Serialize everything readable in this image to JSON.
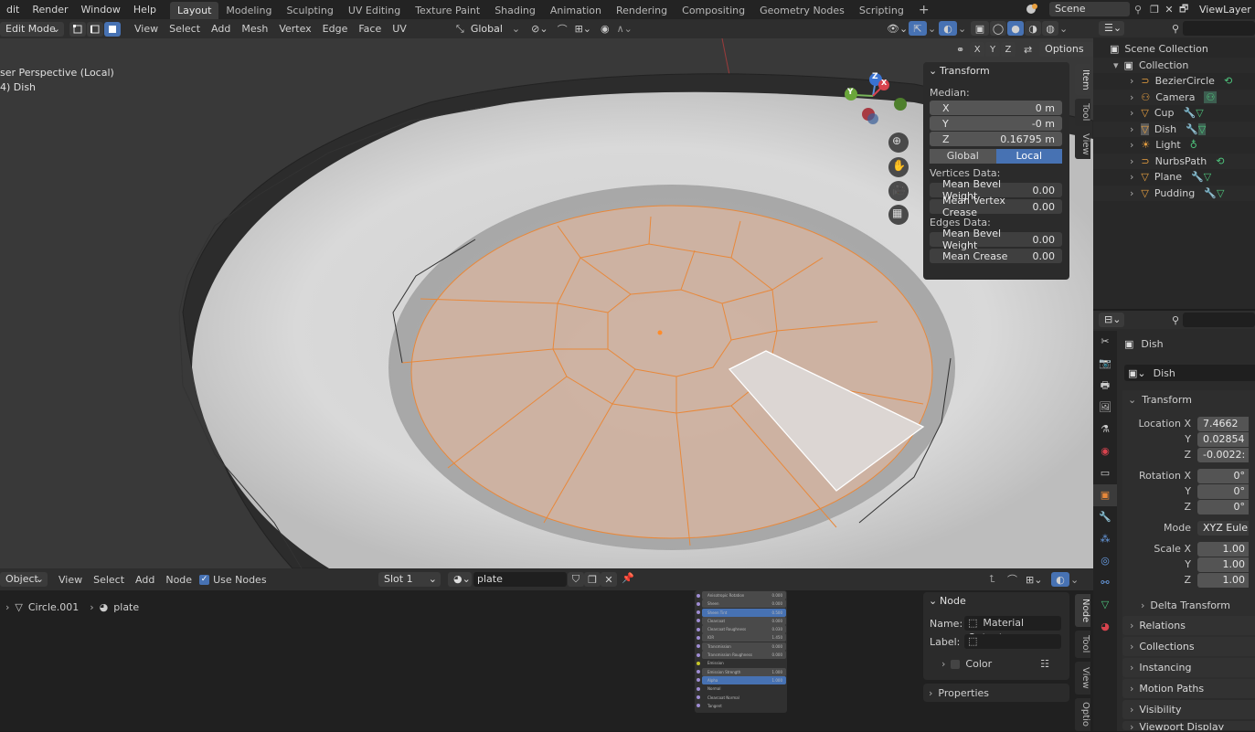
{
  "topbar": {
    "menus": [
      "dit",
      "Render",
      "Window",
      "Help"
    ],
    "workspace_tabs": [
      "Layout",
      "Modeling",
      "Sculpting",
      "UV Editing",
      "Texture Paint",
      "Shading",
      "Animation",
      "Rendering",
      "Compositing",
      "Geometry Nodes",
      "Scripting"
    ],
    "active_tab": "Layout",
    "add_tab": "+",
    "scene": "Scene",
    "view_layer": "ViewLayer"
  },
  "viewport_header": {
    "mode": "Edit Mode",
    "menus": [
      "View",
      "Select",
      "Add",
      "Mesh",
      "Vertex",
      "Edge",
      "Face",
      "UV"
    ],
    "orientation": "Global",
    "options_label": "Options",
    "axes": [
      "X",
      "Y",
      "Z"
    ]
  },
  "viewport": {
    "perspective_label": "ser Perspective (Local)",
    "object_label": "4) Dish",
    "gizmo_axes": [
      "Y",
      "Z",
      "X"
    ]
  },
  "npanel": {
    "title": "Transform",
    "median_label": "Median:",
    "x_label": "X",
    "x_value": "0 m",
    "y_label": "Y",
    "y_value": "-0 m",
    "z_label": "Z",
    "z_value": "0.16795 m",
    "global_label": "Global",
    "local_label": "Local",
    "vertices_data_label": "Vertices Data:",
    "mean_bevel_weight_label": "Mean Bevel Weight",
    "mean_bevel_weight_value": "0.00",
    "mean_vertex_crease_label": "Mean Vertex Crease",
    "mean_vertex_crease_value": "0.00",
    "edges_data_label": "Edges Data:",
    "edge_bevel_weight_label": "Mean Bevel Weight",
    "edge_bevel_weight_value": "0.00",
    "mean_crease_label": "Mean Crease",
    "mean_crease_value": "0.00",
    "side_tabs": [
      "Item",
      "Tool",
      "View"
    ]
  },
  "outliner": {
    "scene_collection": "Scene Collection",
    "collection": "Collection",
    "items": [
      {
        "name": "BezierCircle",
        "color": "#e8a040"
      },
      {
        "name": "Camera",
        "color": "#e8a040"
      },
      {
        "name": "Cup",
        "color": "#e8a040"
      },
      {
        "name": "Dish",
        "color": "#e8a040"
      },
      {
        "name": "Light",
        "color": "#e8a040"
      },
      {
        "name": "NurbsPath",
        "color": "#e8a040"
      },
      {
        "name": "Plane",
        "color": "#e8a040"
      },
      {
        "name": "Pudding",
        "color": "#e8a040"
      }
    ]
  },
  "properties": {
    "object_name": "Dish",
    "data_name": "Dish",
    "transform_label": "Transform",
    "location_x_label": "Location X",
    "location_x": "7.4662",
    "location_y_label": "Y",
    "location_y": "0.02854",
    "location_z_label": "Z",
    "location_z": "-0.0022:",
    "rotation_x_label": "Rotation X",
    "rotation_x": "0°",
    "rotation_y_label": "Y",
    "rotation_y": "0°",
    "rotation_z_label": "Z",
    "rotation_z": "0°",
    "mode_label": "Mode",
    "mode_value": "XYZ Euler",
    "scale_x_label": "Scale X",
    "scale_x": "1.00",
    "scale_y_label": "Y",
    "scale_y": "1.00",
    "scale_z_label": "Z",
    "scale_z": "1.00",
    "delta_transform": "Delta Transform",
    "sections": [
      "Relations",
      "Collections",
      "Instancing",
      "Motion Paths",
      "Visibility",
      "Viewport Display"
    ]
  },
  "node_editor": {
    "editor_type": "Object",
    "menus": [
      "View",
      "Select",
      "Add",
      "Node"
    ],
    "use_nodes_label": "Use Nodes",
    "slot": "Slot 1",
    "material": "plate",
    "breadcrumb_object": "Circle.001",
    "breadcrumb_material": "plate",
    "node_panel_title": "Node",
    "name_label": "Name:",
    "name_value": "Material Output",
    "label_label": "Label:",
    "label_value": "",
    "color_label": "Color",
    "properties_label": "Properties",
    "side_tabs": [
      "Node",
      "Tool",
      "View",
      "Optio"
    ],
    "node_rows": [
      {
        "label": "Anisotropic Rotation",
        "value": "0.000",
        "kind": "field"
      },
      {
        "label": "Sheen",
        "value": "0.000",
        "kind": "field"
      },
      {
        "label": "Sheen Tint",
        "value": "0.500",
        "kind": "blue"
      },
      {
        "label": "Clearcoat",
        "value": "0.000",
        "kind": "field"
      },
      {
        "label": "Clearcoat Roughness",
        "value": "0.030",
        "kind": "field"
      },
      {
        "label": "IOR",
        "value": "1.450",
        "kind": "field"
      },
      {
        "label": "Transmission",
        "value": "0.000",
        "kind": "field"
      },
      {
        "label": "Transmission Roughness",
        "value": "0.000",
        "kind": "field"
      },
      {
        "label": "Emission",
        "value": "",
        "kind": "plain"
      },
      {
        "label": "Emission Strength",
        "value": "1.000",
        "kind": "field"
      },
      {
        "label": "Alpha",
        "value": "1.000",
        "kind": "blue"
      },
      {
        "label": "Normal",
        "value": "",
        "kind": "plain"
      },
      {
        "label": "Clearcoat Normal",
        "value": "",
        "kind": "plain"
      },
      {
        "label": "Tangent",
        "value": "",
        "kind": "plain"
      }
    ]
  },
  "colors": {
    "accent": "#4772b3",
    "selection": "#e8883a",
    "face_selected": "#c9a089"
  }
}
